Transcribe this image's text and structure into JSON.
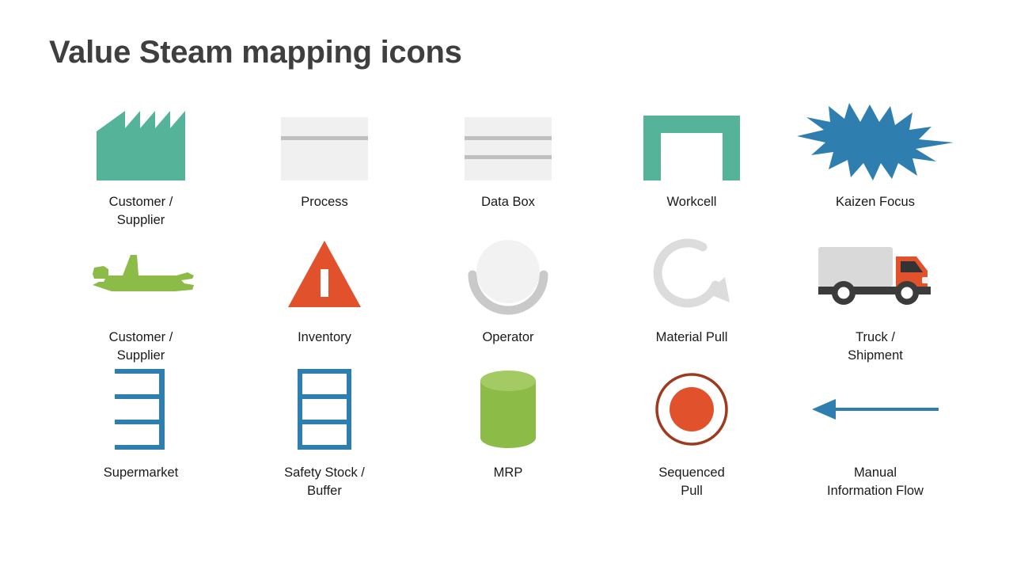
{
  "slide": {
    "title": "Value Steam mapping icons",
    "background": "#ffffff",
    "title_color": "#3f3f3f"
  },
  "palette": {
    "teal": "#55b399",
    "blue": "#2e7fb0",
    "green": "#8cbc47",
    "green_light": "#a4ca63",
    "orange": "#e1512c",
    "dark_red": "#9e3a20",
    "gray_light": "#f0f0f0",
    "gray_line": "#bfbfbf",
    "gray_mid": "#d9d9d9",
    "gray_dark": "#3b3b3b",
    "text": "#1a1a1a"
  },
  "rows": [
    {
      "row_name": "row-1",
      "items": [
        {
          "icon": "factory-icon",
          "label": "Customer /\nSupplier",
          "color": "#55b399"
        },
        {
          "icon": "process-box-icon",
          "label": "Process",
          "color": "#f0f0f0"
        },
        {
          "icon": "data-box-icon",
          "label": "Data Box",
          "color": "#f0f0f0"
        },
        {
          "icon": "workcell-icon",
          "label": "Workcell",
          "color": "#55b399"
        },
        {
          "icon": "kaizen-burst-icon",
          "label": "Kaizen Focus",
          "color": "#2e7fb0"
        }
      ]
    },
    {
      "row_name": "row-2",
      "items": [
        {
          "icon": "airplane-icon",
          "label": "Customer /\nSupplier",
          "color": "#8cbc47"
        },
        {
          "icon": "inventory-triangle-icon",
          "label": "Inventory",
          "color": "#e1512c"
        },
        {
          "icon": "operator-icon",
          "label": "Operator",
          "color": "#f2f2f2"
        },
        {
          "icon": "material-pull-arrow-icon",
          "label": "Material Pull",
          "color": "#dcdcdc"
        },
        {
          "icon": "truck-icon",
          "label": "Truck /\nShipment",
          "color": "#e1512c"
        }
      ]
    },
    {
      "row_name": "row-3",
      "items": [
        {
          "icon": "supermarket-icon",
          "label": "Supermarket",
          "color": "#2e7fb0"
        },
        {
          "icon": "safety-stock-icon",
          "label": "Safety Stock /\nBuffer",
          "color": "#2e7fb0"
        },
        {
          "icon": "mrp-cylinder-icon",
          "label": "MRP",
          "color": "#8cbc47"
        },
        {
          "icon": "sequenced-pull-icon",
          "label": "Sequenced\nPull",
          "color": "#e1512c"
        },
        {
          "icon": "manual-info-flow-arrow-icon",
          "label": "Manual\nInformation Flow",
          "color": "#2e7fb0"
        }
      ]
    }
  ]
}
